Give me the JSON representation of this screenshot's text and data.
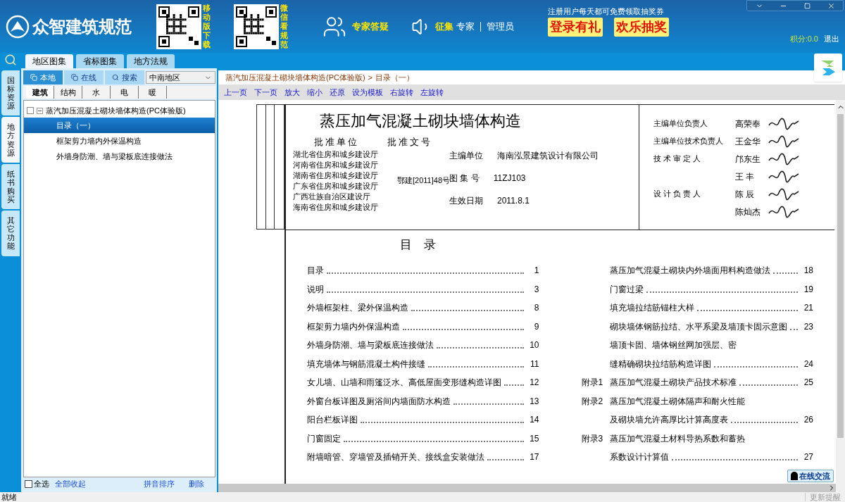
{
  "header": {
    "logo_text": "众智建筑规范",
    "qr_codes": [
      {
        "caption": "移动版下载"
      },
      {
        "caption": "微信看规范"
      }
    ],
    "expert_link": "专家答疑",
    "collect_label": "征集",
    "collect_link": "专家",
    "admin_link": "管理员",
    "promo_note": "注册用户每天都可免费领取抽奖券",
    "promo_headlines": [
      "登录有礼",
      "欢乐抽奖"
    ],
    "points": "积分:0.0",
    "logout": "退出"
  },
  "tabs": [
    {
      "label": "地区图集",
      "selected": true
    },
    {
      "label": "省标图集",
      "selected": false
    },
    {
      "label": "地方法规",
      "selected": false
    }
  ],
  "side_tabs": [
    {
      "label": "国标资源",
      "selected": false
    },
    {
      "label": "地方资源",
      "selected": true
    },
    {
      "label": "纸书购买",
      "selected": false
    },
    {
      "label": "其它功能",
      "selected": false
    }
  ],
  "source_buttons": [
    {
      "label": "本地",
      "selected": true
    },
    {
      "label": "在线",
      "selected": false
    },
    {
      "label": "搜索",
      "selected": false
    }
  ],
  "region_select": "中南地区",
  "categories": [
    {
      "label": "建筑",
      "selected": true
    },
    {
      "label": "结构",
      "selected": false
    },
    {
      "label": "水",
      "selected": false
    },
    {
      "label": "电",
      "selected": false
    },
    {
      "label": "暖",
      "selected": false
    }
  ],
  "tree": [
    {
      "label": "蒸汽加压混凝土砌块墙体构造(PC体验版)",
      "checked": false,
      "expanded": true,
      "children": [
        {
          "label": "目录（一）",
          "selected": true
        },
        {
          "label": "框架剪力墙内外保温构造",
          "selected": false
        },
        {
          "label": "外墙身防潮、墙与梁板底连接做法",
          "selected": false
        }
      ]
    }
  ],
  "panel_footer": {
    "select_all": {
      "label": "全选",
      "checked": false
    },
    "collapse_all": "全部收起",
    "sort": "拼音排序",
    "delete": "删除"
  },
  "breadcrumb": [
    "蒸汽加压混凝土砌块墙体构造(PC体验版)",
    "目录（一）"
  ],
  "breadcrumb_separator": ">",
  "toolbar": [
    "上一页",
    "下一页",
    "放大",
    "缩小",
    "还原",
    "设为模板",
    "右旋转",
    "左旋转"
  ],
  "document": {
    "title": "蒸压加气混凝土砌块墙体构造",
    "approval_unit_heading": "批准单位",
    "approval_number_heading": "批准文号",
    "approval_units": [
      "湖北省住房和城乡建设厅",
      "河南省住房和城乡建设厅",
      "湖南省住房和城乡建设厅",
      "广东省住房和城乡建设厅",
      "广西壮族自治区建设厅",
      "海南省住房和城乡建设厅"
    ],
    "approval_number": "鄂建[2011]48号",
    "fields": [
      {
        "label": "主编单位",
        "value": "海南泓景建筑设计有限公司"
      },
      {
        "label": "图 集 号",
        "value": "11ZJ103"
      },
      {
        "label": "生效日期",
        "value": "2011.8.1"
      }
    ],
    "people": [
      {
        "role": "主编单位负责人",
        "name": "高荣奉"
      },
      {
        "role": "主编单位技术负责人",
        "name": "王金华"
      },
      {
        "role": "技 术 审 定 人",
        "name": "邝东生"
      },
      {
        "name": "王 丰"
      },
      {
        "role": "设 计 负 责 人",
        "name": "陈 辰"
      },
      {
        "name": "陈灿杰"
      }
    ],
    "toc_title": "目　录",
    "toc_left": [
      {
        "text": "目录",
        "page": "1"
      },
      {
        "text": "说明",
        "page": "3"
      },
      {
        "text": "外墙框架柱、梁外保温构造",
        "page": "8"
      },
      {
        "text": "框架剪力墙内外保温构造",
        "page": "9"
      },
      {
        "text": "外墙身防潮、墙与梁板底连接做法",
        "page": "10"
      },
      {
        "text": "填充墙体与钢筋混凝土构件接缝",
        "page": "11"
      },
      {
        "text": "女儿墙、山墙和雨篷泛水、高低屋面变形缝构造详图",
        "page": "12"
      },
      {
        "text": "外窗台板详图及厕浴间内墙面防水构造",
        "page": "13"
      },
      {
        "text": "阳台栏板详图",
        "page": "14"
      },
      {
        "text": "门窗固定",
        "page": "15"
      },
      {
        "text": "附墙暗管、穿墙管及插销开关、接线盒安装做法",
        "page": "17"
      }
    ],
    "toc_right": [
      {
        "text": "蒸压加气混凝土砌块内外墙面用料构造做法",
        "page": "18"
      },
      {
        "text": "门窗过梁",
        "page": "19"
      },
      {
        "text": "填充墙拉结筋锚柱大样",
        "page": "21"
      },
      {
        "text": "砌块墙体钢筋拉结、水平系梁及墙顶卡固示意图",
        "page": "23"
      },
      {
        "text": "墙顶卡固、墙体钢丝网加强层、密"
      },
      {
        "text": "缝精确砌块拉结筋构造详图",
        "page": "24"
      },
      {
        "prefix": "附录1",
        "text": "蒸压加气混凝土砌块产品技术标准",
        "page": "25"
      },
      {
        "prefix": "附录2",
        "text": "蒸压加气混凝土砌体隔声和耐火性能"
      },
      {
        "text": "及砌块墙允许高厚比计算高度表",
        "page": "26"
      },
      {
        "prefix": "附录3",
        "text": "蒸压加气混凝土材料导热系数和蓄热"
      },
      {
        "text": "系数设计计算值",
        "page": "27"
      }
    ]
  },
  "chat_badge": "在线交流",
  "status_bar": {
    "left": "就绪",
    "right": "更新提醒"
  }
}
